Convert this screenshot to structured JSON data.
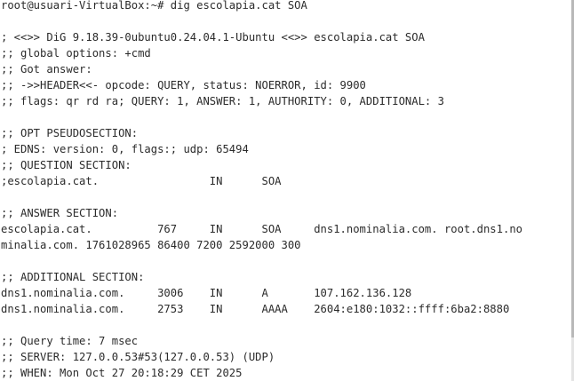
{
  "terminal": {
    "lines": [
      "root@usuari-VirtualBox:~# dig escolapia.cat SOA",
      "",
      "; <<>> DiG 9.18.39-0ubuntu0.24.04.1-Ubuntu <<>> escolapia.cat SOA",
      ";; global options: +cmd",
      ";; Got answer:",
      ";; ->>HEADER<<- opcode: QUERY, status: NOERROR, id: 9900",
      ";; flags: qr rd ra; QUERY: 1, ANSWER: 1, AUTHORITY: 0, ADDITIONAL: 3",
      "",
      ";; OPT PSEUDOSECTION:",
      "; EDNS: version: 0, flags:; udp: 65494",
      ";; QUESTION SECTION:",
      ";escolapia.cat.                 IN      SOA",
      "",
      ";; ANSWER SECTION:",
      "escolapia.cat.          767     IN      SOA     dns1.nominalia.com. root.dns1.no",
      "minalia.com. 1761028965 86400 7200 2592000 300",
      "",
      ";; ADDITIONAL SECTION:",
      "dns1.nominalia.com.     3006    IN      A       107.162.136.128",
      "dns1.nominalia.com.     2753    IN      AAAA    2604:e180:1032::ffff:6ba2:8880",
      "",
      ";; Query time: 7 msec",
      ";; SERVER: 127.0.0.53#53(127.0.0.53) (UDP)",
      ";; WHEN: Mon Oct 27 20:18:29 CET 2025"
    ]
  }
}
